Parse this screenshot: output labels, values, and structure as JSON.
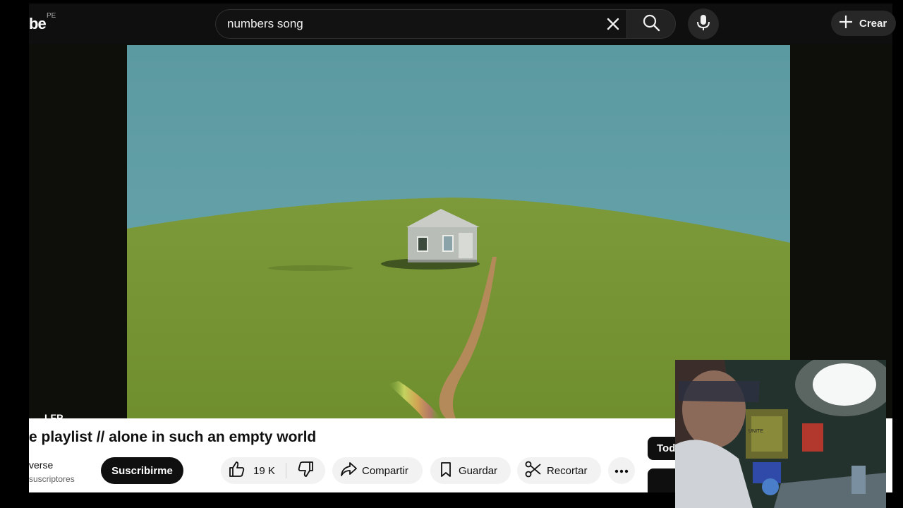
{
  "header": {
    "logo_text": "be",
    "region": "PE",
    "search": {
      "value": "numbers song"
    },
    "create_label": "Crear"
  },
  "video": {
    "title": "e playlist // alone in such an empty world",
    "overlay_text": "LFP"
  },
  "channel": {
    "name": "verse",
    "subscribers": "suscriptores",
    "subscribe_label": "Suscribirme"
  },
  "actions": {
    "likes": "19 K",
    "share_label": "Compartir",
    "save_label": "Guardar",
    "clip_label": "Recortar"
  },
  "chips": {
    "all_label": "Todos"
  },
  "webcam_sign": "UNITE"
}
